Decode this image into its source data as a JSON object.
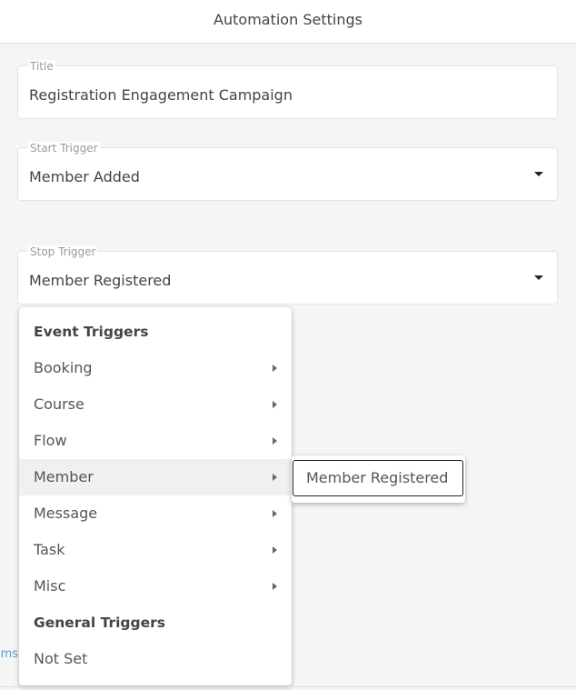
{
  "header": {
    "title": "Automation Settings"
  },
  "form": {
    "title": {
      "label": "Title",
      "value": "Registration Engagement Campaign"
    },
    "start_trigger": {
      "label": "Start Trigger",
      "value": "Member Added"
    },
    "stop_trigger": {
      "label": "Stop Trigger",
      "value": "Member Registered"
    }
  },
  "dropdown": {
    "event_header": "Event Triggers",
    "items": [
      {
        "label": "Booking"
      },
      {
        "label": "Course"
      },
      {
        "label": "Flow"
      },
      {
        "label": "Member"
      },
      {
        "label": "Message"
      },
      {
        "label": "Task"
      },
      {
        "label": "Misc"
      }
    ],
    "general_header": "General Triggers",
    "not_set": "Not Set"
  },
  "submenu": {
    "item": "Member Registered"
  },
  "background": {
    "partial_link": "ms"
  }
}
